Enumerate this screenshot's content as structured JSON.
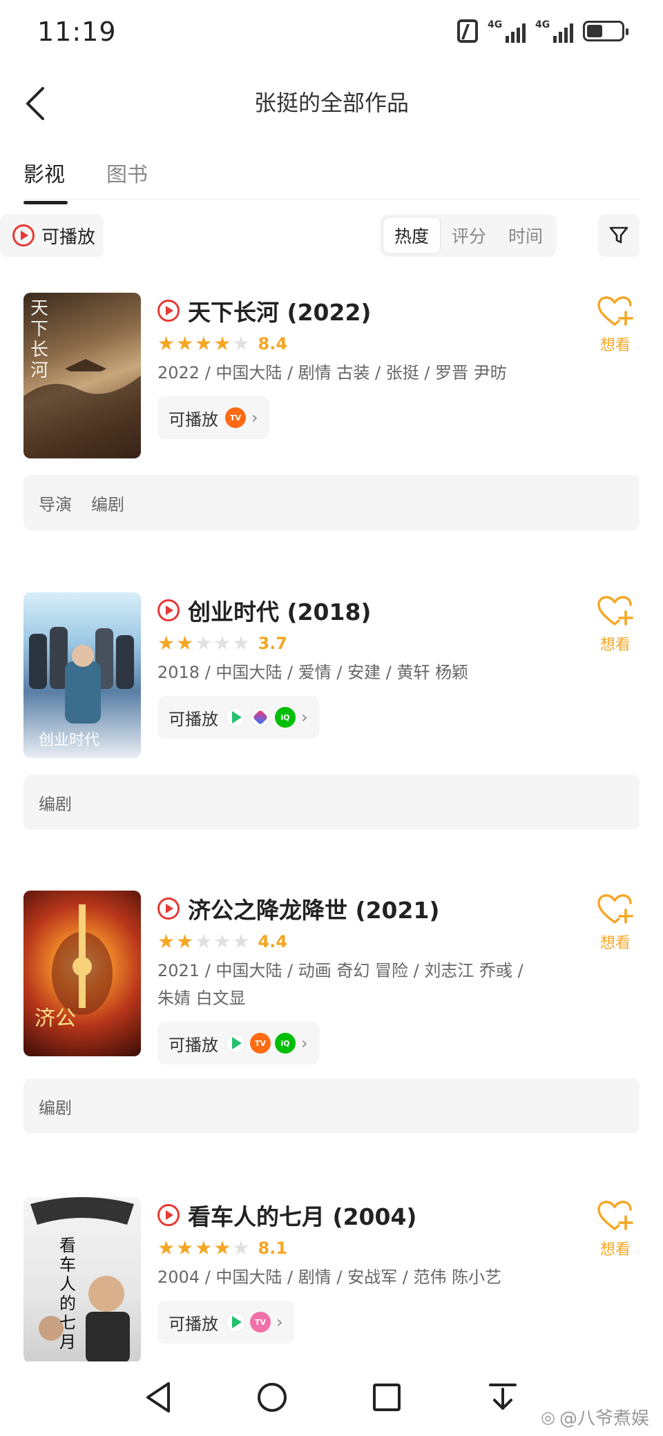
{
  "status_bar": {
    "time": "11:19",
    "network_1": "4G",
    "network_2": "4G"
  },
  "header": {
    "title": "张挺的全部作品"
  },
  "tabs": [
    {
      "label": "影视",
      "active": true
    },
    {
      "label": "图书",
      "active": false
    }
  ],
  "filters": {
    "playable_label": "可播放",
    "sort_options": [
      {
        "label": "热度",
        "active": true
      },
      {
        "label": "评分",
        "active": false
      },
      {
        "label": "时间",
        "active": false
      }
    ]
  },
  "want_label": "想看",
  "works": [
    {
      "title": "天下长河 (2022)",
      "stars": 4,
      "score": "8.4",
      "meta": "2022 / 中国大陆 / 剧情 古装 / 张挺 / 罗晋 尹昉",
      "meta_line2": "",
      "play_label": "可播放",
      "platforms": [
        "mango-icon"
      ],
      "roles": [
        "导演",
        "编剧"
      ],
      "poster_text": "天下长河"
    },
    {
      "title": "创业时代 (2018)",
      "stars": 2,
      "score": "3.7",
      "meta": "2018 / 中国大陆 / 爱情 / 安建 / 黄轩 杨颖",
      "meta_line2": "",
      "play_label": "可播放",
      "platforms": [
        "tencent-video-icon",
        "youku-icon",
        "iqiyi-icon"
      ],
      "roles": [
        "编剧"
      ],
      "poster_text": "创业时代"
    },
    {
      "title": "济公之降龙降世 (2021)",
      "stars": 2,
      "score": "4.4",
      "meta": "2021 / 中国大陆 / 动画 奇幻 冒险 / 刘志江 乔彧 /",
      "meta_line2": "朱婧 白文显",
      "play_label": "可播放",
      "platforms": [
        "tencent-video-icon",
        "mango-icon",
        "iqiyi-icon"
      ],
      "roles": [
        "编剧"
      ],
      "poster_text": "济公"
    },
    {
      "title": "看车人的七月 (2004)",
      "stars": 4,
      "score": "8.1",
      "meta": "2004 / 中国大陆 / 剧情 / 安战军 / 范伟 陈小艺",
      "meta_line2": "",
      "play_label": "可播放",
      "platforms": [
        "tencent-video-icon",
        "misc-platform-icon"
      ],
      "roles": [],
      "poster_text": "看车人的七月"
    }
  ],
  "colors": {
    "accent": "#f5a623",
    "play_red": "#e53935"
  },
  "watermark": "@八爷煮娱"
}
